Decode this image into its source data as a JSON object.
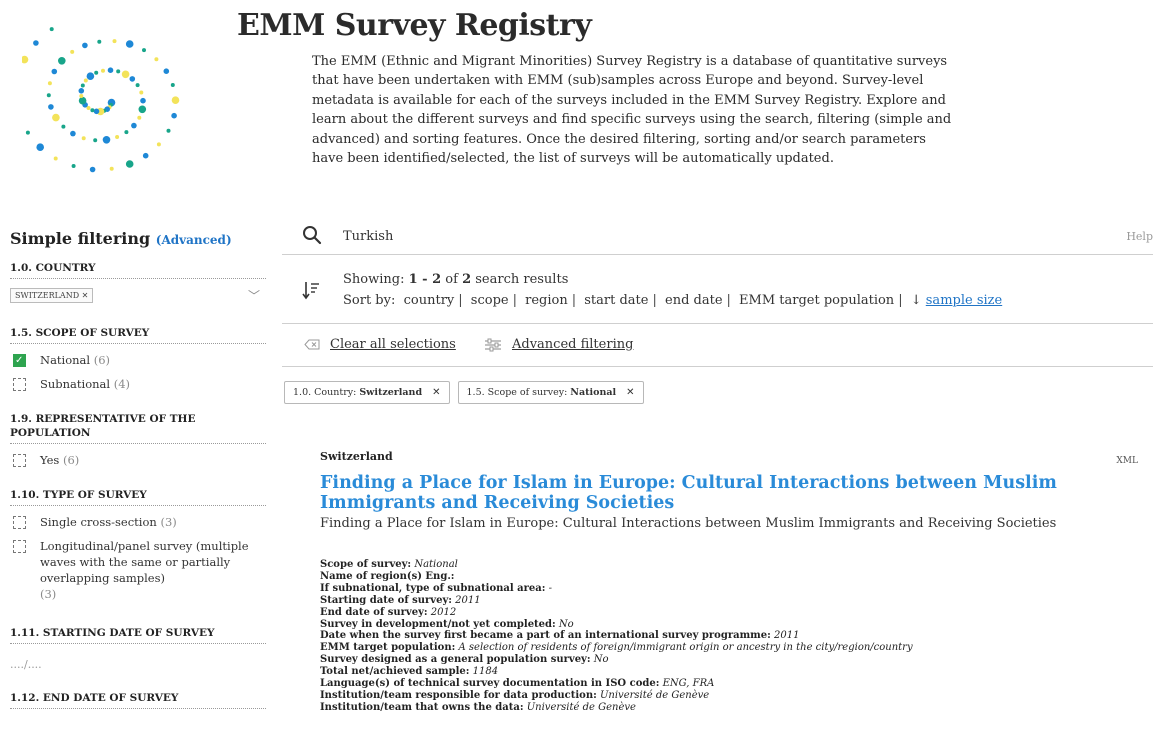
{
  "header": {
    "title": "EMM Survey Registry",
    "intro": "The EMM (Ethnic and Migrant Minorities) Survey Registry is a database of quantitative surveys that have been undertaken with EMM (sub)samples across Europe and beyond. Survey-level metadata is available for each of the surveys included in the EMM Survey Registry. Explore and learn about the different surveys and find specific surveys using the search, filtering (simple and advanced) and sorting features. Once the desired filtering, sorting and/or search parameters have been identified/selected, the list of surveys will be automatically updated."
  },
  "logo": {
    "icon": "spiral-dots-logo",
    "colors": [
      "#1e88d6",
      "#18a58a",
      "#f3e35a"
    ]
  },
  "sidebar": {
    "title": "Simple filtering",
    "advanced_link": "(Advanced)",
    "country": {
      "heading": "1.0. COUNTRY",
      "chip": "SWITZERLAND",
      "chip_close": "✕",
      "chevron": "﹀"
    },
    "scope": {
      "heading": "1.5. SCOPE OF SURVEY",
      "options": [
        {
          "label": "National",
          "count": "(6)",
          "checked": true
        },
        {
          "label": "Subnational",
          "count": "(4)",
          "checked": false
        }
      ]
    },
    "representative": {
      "heading": "1.9. REPRESENTATIVE OF THE POPULATION",
      "options": [
        {
          "label": "Yes",
          "count": "(6)",
          "checked": false
        }
      ]
    },
    "type": {
      "heading": "1.10. TYPE OF SURVEY",
      "options": [
        {
          "label": "Single cross-section",
          "count": "(3)",
          "checked": false
        },
        {
          "label": "Longitudinal/panel survey (multiple waves with the same or partially overlapping samples)",
          "count": "(3)",
          "checked": false
        }
      ]
    },
    "start_date": {
      "heading": "1.11. STARTING DATE OF SURVEY",
      "value": "..../...."
    },
    "end_date": {
      "heading": "1.12. END DATE OF SURVEY"
    }
  },
  "search": {
    "query": "Turkish",
    "help": "Help",
    "icon": "search-icon"
  },
  "results": {
    "showing_prefix": "Showing: ",
    "showing_range": "1 - 2",
    "showing_of": " of ",
    "showing_total": "2",
    "showing_suffix": " search results",
    "sort_label": "Sort by:",
    "sort_options": [
      "country",
      "scope",
      "region",
      "start date",
      "end date",
      "EMM target population"
    ],
    "sort_active_arrow": "↓",
    "sort_active": "sample size"
  },
  "actions": {
    "clear": "Clear all selections",
    "advanced": "Advanced filtering"
  },
  "active_filters": [
    {
      "label": "1.0. Country:",
      "value": "Switzerland",
      "close": "✕"
    },
    {
      "label": "1.5. Scope of survey:",
      "value": "National",
      "close": "✕"
    }
  ],
  "result": {
    "country": "Switzerland",
    "xml": "XML",
    "title": "Finding a Place for Islam in Europe: Cultural Interactions between Muslim Immigrants and Receiving Societies",
    "subtitle": "Finding a Place for Islam in Europe: Cultural Interactions between Muslim Immigrants and Receiving Societies",
    "meta": [
      {
        "k": "Scope of survey:",
        "v": "National"
      },
      {
        "k": "Name of region(s) Eng.:",
        "v": ""
      },
      {
        "k": "If subnational, type of subnational area:",
        "v": "-"
      },
      {
        "k": "Starting date of survey:",
        "v": "2011"
      },
      {
        "k": "End date of survey:",
        "v": "2012"
      },
      {
        "k": "Survey in development/not yet completed:",
        "v": "No"
      },
      {
        "k": "Date when the survey first became a part of an international survey programme:",
        "v": "2011"
      },
      {
        "k": "EMM target population:",
        "v": "A selection of residents of foreign/immigrant origin or ancestry in the city/region/country"
      },
      {
        "k": "Survey designed as a general population survey:",
        "v": "No"
      },
      {
        "k": "Total net/achieved sample:",
        "v": "1184"
      },
      {
        "k": "Language(s) of technical survey documentation in ISO code:",
        "v": "ENG, FRA"
      },
      {
        "k": "Institution/team responsible for data production:",
        "v": "Université de Genève"
      },
      {
        "k": "Institution/team that owns the data:",
        "v": "Université de Genève"
      }
    ]
  }
}
